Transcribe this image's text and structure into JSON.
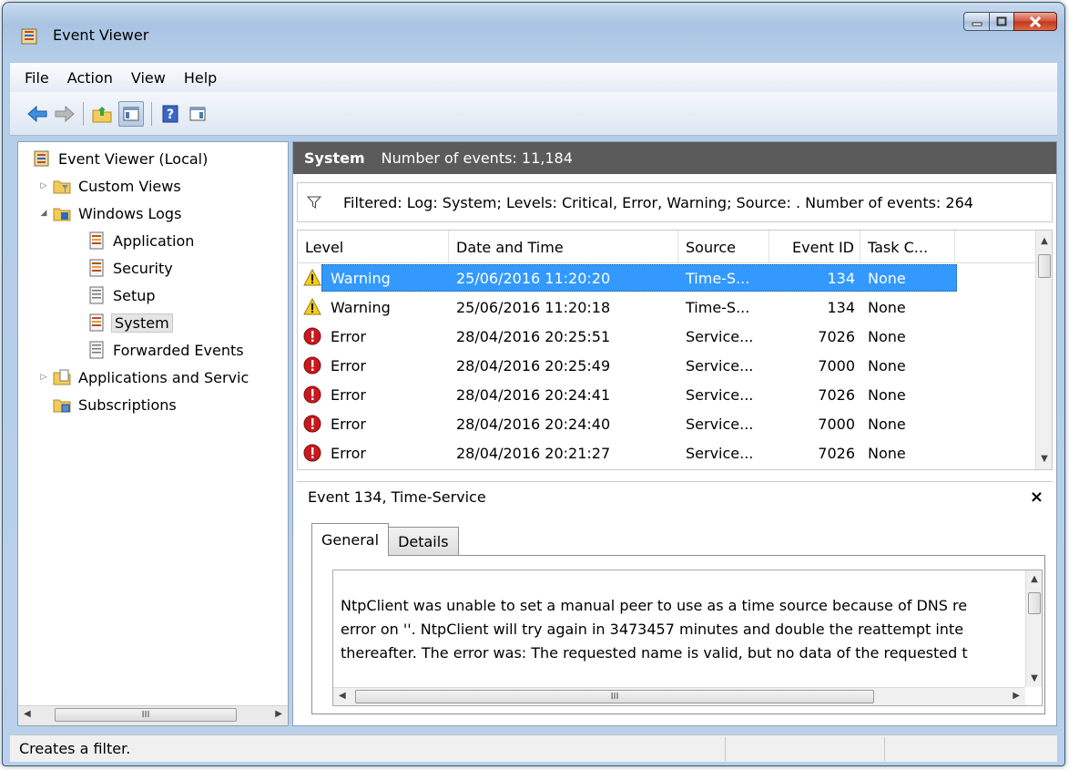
{
  "window": {
    "title": "Event Viewer"
  },
  "menu": [
    "File",
    "Action",
    "View",
    "Help"
  ],
  "toolbar": {
    "icons": [
      "back-arrow-icon",
      "forward-arrow-icon",
      "up-folder-icon",
      "show-hide-tree-icon",
      "help-icon",
      "show-hide-action-pane-icon"
    ]
  },
  "tree": {
    "root": "Event Viewer (Local)",
    "custom_views": "Custom Views",
    "windows_logs": "Windows Logs",
    "application": "Application",
    "security": "Security",
    "setup": "Setup",
    "system": "System",
    "forwarded": "Forwarded Events",
    "apps_services": "Applications and Servic",
    "subscriptions": "Subscriptions"
  },
  "header": {
    "log": "System",
    "count": "Number of events: 11,184"
  },
  "filter": {
    "text": "Filtered: Log: System; Levels: Critical, Error, Warning; Source: . Number of events: 264"
  },
  "columns": {
    "level": "Level",
    "datetime": "Date and Time",
    "source": "Source",
    "event_id": "Event ID",
    "task": "Task C..."
  },
  "events": [
    {
      "level": "Warning",
      "datetime": "25/06/2016 11:20:20",
      "source": "Time-S...",
      "event_id": "134",
      "task": "None"
    },
    {
      "level": "Warning",
      "datetime": "25/06/2016 11:20:18",
      "source": "Time-S...",
      "event_id": "134",
      "task": "None"
    },
    {
      "level": "Error",
      "datetime": "28/04/2016 20:25:51",
      "source": "Service...",
      "event_id": "7026",
      "task": "None"
    },
    {
      "level": "Error",
      "datetime": "28/04/2016 20:25:49",
      "source": "Service...",
      "event_id": "7000",
      "task": "None"
    },
    {
      "level": "Error",
      "datetime": "28/04/2016 20:24:41",
      "source": "Service...",
      "event_id": "7026",
      "task": "None"
    },
    {
      "level": "Error",
      "datetime": "28/04/2016 20:24:40",
      "source": "Service...",
      "event_id": "7000",
      "task": "None"
    },
    {
      "level": "Error",
      "datetime": "28/04/2016 20:21:27",
      "source": "Service...",
      "event_id": "7026",
      "task": "None"
    }
  ],
  "detail": {
    "title": "Event 134, Time-Service",
    "close": "×",
    "tabs": [
      "General",
      "Details"
    ],
    "lines": [
      "NtpClient was unable to set a manual peer to use as a time source because of DNS re",
      "error on ''. NtpClient will try again in 3473457 minutes and double the reattempt inte",
      "thereafter. The error was: The requested name is valid, but no data of the requested t"
    ],
    "hscroll_grip": "III"
  },
  "left_hscroll_grip": "III",
  "status": {
    "text": "Creates a filter."
  },
  "colors": {
    "selection": "#3399ff",
    "header_bg": "#5b5b5b",
    "error": "#c8191f",
    "warning": "#f3cf1b"
  }
}
